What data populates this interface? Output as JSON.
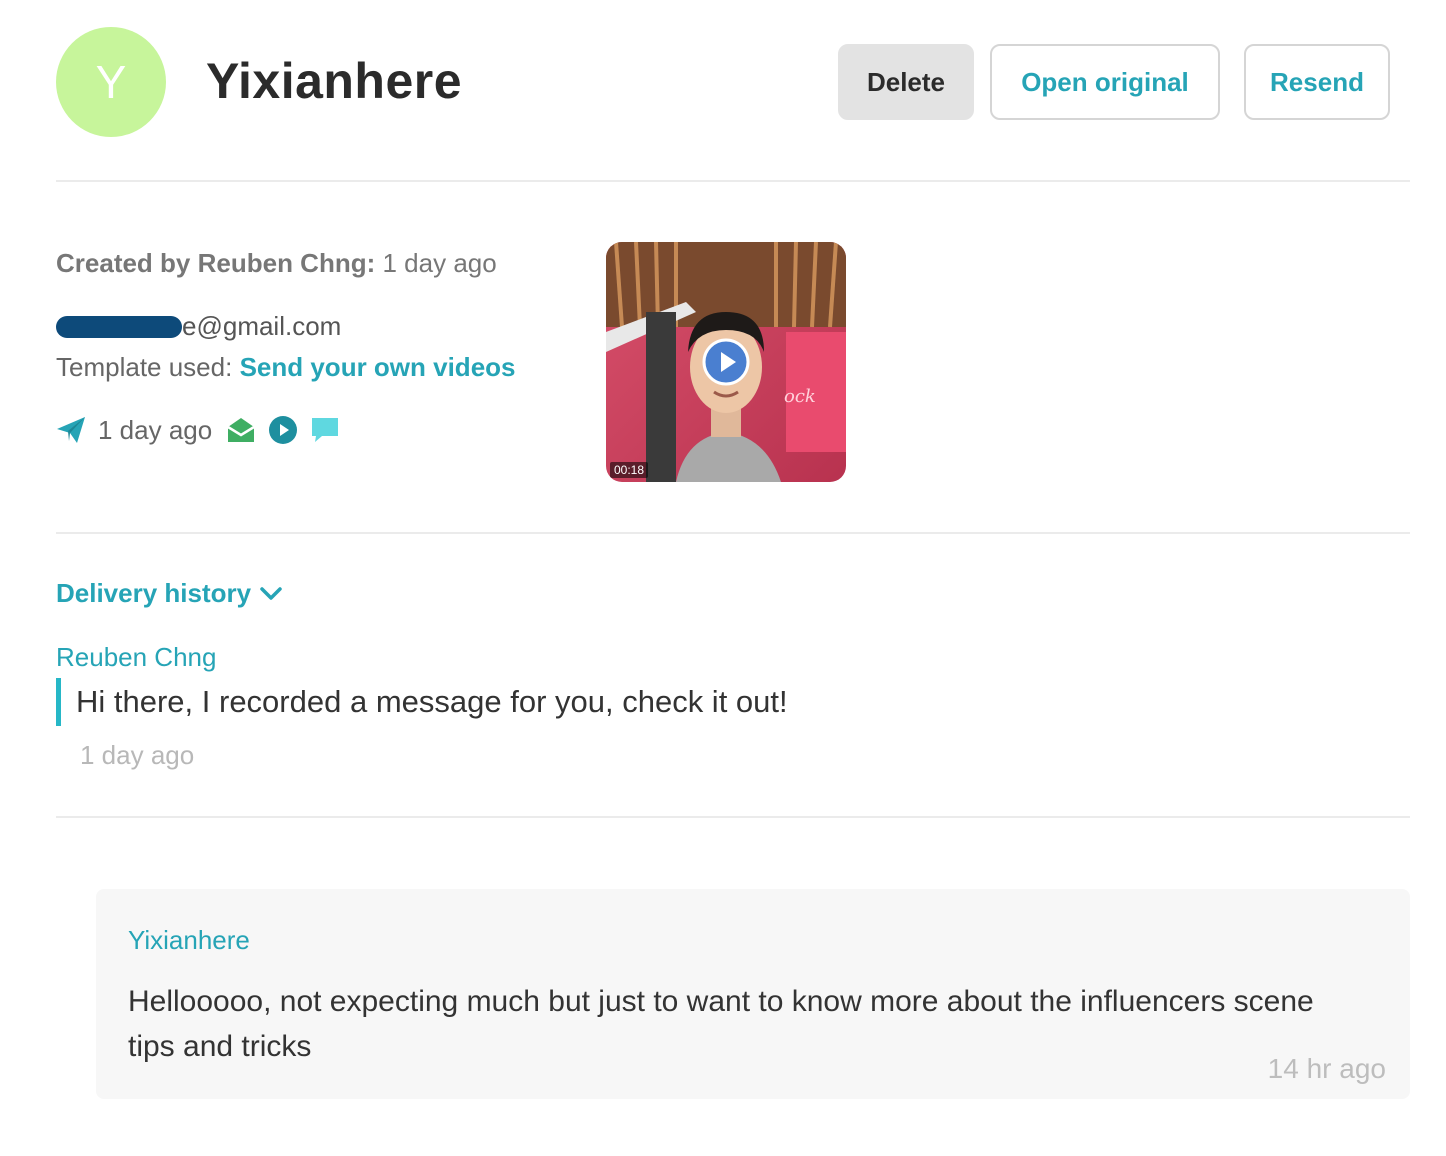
{
  "header": {
    "avatar_letter": "Y",
    "avatar_color": "#c7f59b",
    "contact_name": "Yixianhere",
    "buttons": {
      "delete": "Delete",
      "open_original": "Open original",
      "resend": "Resend"
    }
  },
  "details": {
    "created_by_label": "Created by Reuben Chng",
    "created_time": "1 day ago",
    "email_visible_suffix": "e@gmail.com",
    "template_label": "Template used:",
    "template_link": "Send your own videos",
    "sent_time": "1 day ago",
    "status_icons": [
      "paper-plane-icon",
      "opened-envelope-icon",
      "play-circle-icon",
      "speech-bubble-icon"
    ]
  },
  "video": {
    "duration": "00:18"
  },
  "history": {
    "toggle_label": "Delivery history",
    "sender": "Reuben Chng",
    "message": "Hi there, I recorded a message for you, check it out!",
    "time": "1 day ago"
  },
  "reply": {
    "name": "Yixianhere",
    "text": "Hellooooo, not expecting much but just to want to know more about the influencers scene tips and tricks",
    "time": "14 hr ago"
  },
  "colors": {
    "accent": "#26a4b6",
    "quote_bar": "#26b7c7",
    "envelope_green": "#3fae63",
    "play_teal": "#1e8f9f",
    "bubble_cyan": "#5fd8e0"
  }
}
